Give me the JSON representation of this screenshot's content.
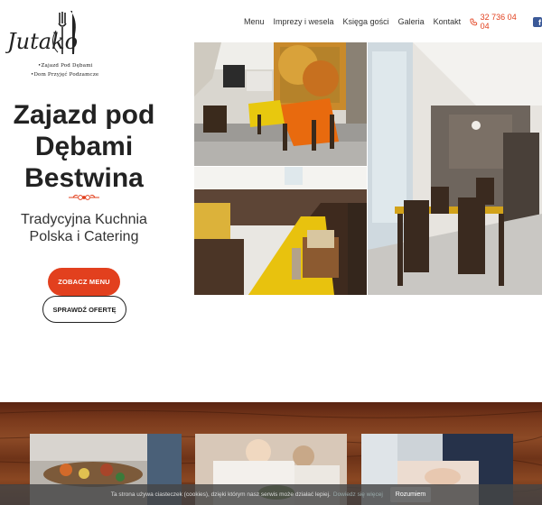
{
  "brand": {
    "logo_script": "Jutako",
    "subline_1": "•Zajazd Pod Dębami",
    "subline_2": "•Dom Przyjęć Podzamcze"
  },
  "nav": {
    "items": [
      "Menu",
      "Imprezy i wesela",
      "Księga gości",
      "Galeria",
      "Kontakt"
    ],
    "phone": "32 736 04 04",
    "facebook_glyph": "f"
  },
  "hero": {
    "title_lines": [
      "Zajazd pod",
      "Dębami",
      "Bestwina"
    ],
    "subtitle_lines": [
      "Tradycyjna Kuchnia",
      "Polska i Catering"
    ],
    "cta_menu": "ZOBACZ MENU",
    "cta_offer": "SPRAWDŹ OFERTĘ"
  },
  "cookie": {
    "text": "Ta strona używa ciasteczek (cookies), dzięki którym nasz serwis może działać lepiej.",
    "link": "Dowiedz się więcej",
    "accept": "Rozumiem"
  },
  "colors": {
    "accent": "#e2401e",
    "facebook": "#3b5998"
  }
}
